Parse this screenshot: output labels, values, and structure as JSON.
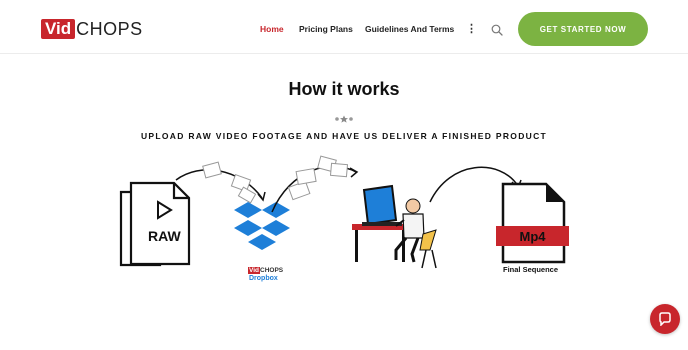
{
  "header": {
    "logo_vid": "Vid",
    "logo_chops": "CHOPS",
    "nav": [
      {
        "label": "Home",
        "active": true
      },
      {
        "label": "Pricing Plans",
        "active": false
      },
      {
        "label": "Guidelines And Terms",
        "active": false
      }
    ],
    "more_icon": "more-vertical-icon",
    "search_icon": "search-icon",
    "cta_label": "GET STARTED NOW"
  },
  "section": {
    "title": "How it works",
    "subtitle": "UPLOAD RAW VIDEO FOOTAGE AND HAVE US DELIVER A FINISHED PRODUCT"
  },
  "illustration": {
    "raw_label": "RAW",
    "dropbox_brand_vid": "Vid",
    "dropbox_brand_chops": "CHOPS",
    "dropbox_label": "Dropbox",
    "output_format": "Mp4",
    "output_caption": "Final Sequence"
  },
  "colors": {
    "brand_red": "#c8262c",
    "cta_green": "#7cb342",
    "dropbox_blue": "#1e7fd8"
  },
  "chat": {
    "icon": "chat-bubble-icon"
  }
}
